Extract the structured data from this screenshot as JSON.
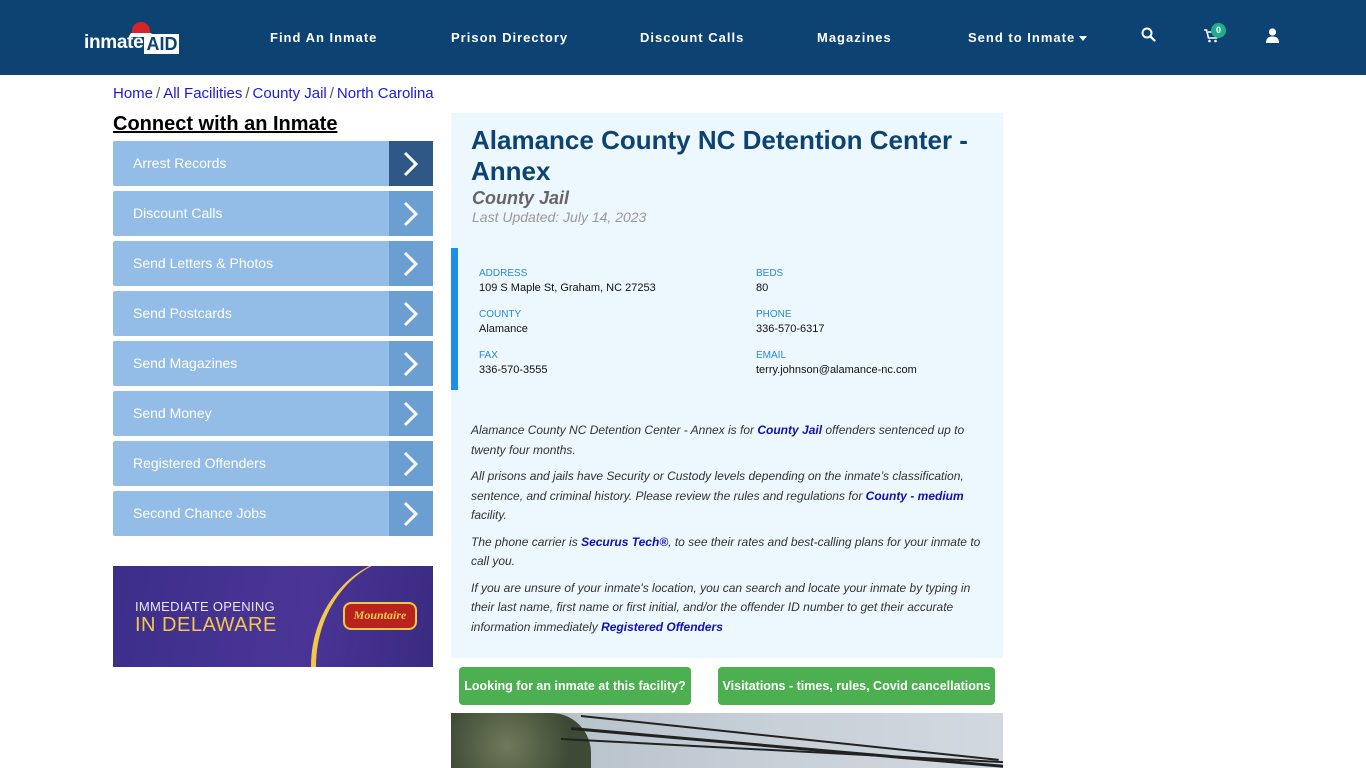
{
  "header": {
    "logo": {
      "text_main": "inmate",
      "text_accent": "AID"
    },
    "nav": [
      {
        "label": "Find An Inmate"
      },
      {
        "label": "Prison Directory"
      },
      {
        "label": "Discount Calls"
      },
      {
        "label": "Magazines"
      },
      {
        "label": "Send to Inmate",
        "has_dropdown": true
      }
    ],
    "icons": [
      "search-icon",
      "cart-icon",
      "user-icon"
    ],
    "cart_count": "0"
  },
  "breadcrumb": [
    {
      "label": "Home"
    },
    {
      "label": "All Facilities"
    },
    {
      "label": "County Jail"
    },
    {
      "label": "North Carolina"
    }
  ],
  "breadcrumb_sep": "/",
  "sidebar": {
    "title": "Connect with an Inmate",
    "items": [
      {
        "label": "Arrest Records"
      },
      {
        "label": "Discount Calls"
      },
      {
        "label": "Send Letters & Photos"
      },
      {
        "label": "Send Postcards"
      },
      {
        "label": "Send Magazines"
      },
      {
        "label": "Send Money"
      },
      {
        "label": "Registered Offenders"
      },
      {
        "label": "Second Chance Jobs"
      }
    ],
    "ad": {
      "line1": "IMMEDIATE OPENING",
      "line2": "IN DELAWARE",
      "brand": "Mountaire"
    }
  },
  "facility": {
    "title": "Alamance County NC Detention Center - Annex",
    "type": "County Jail",
    "last_updated": "Last Updated: July 14, 2023",
    "info": {
      "address_label": "ADDRESS",
      "address": "109 S Maple St, Graham, NC 27253",
      "beds_label": "BEDS",
      "beds": "80",
      "county_label": "COUNTY",
      "county": "Alamance",
      "phone_label": "PHONE",
      "phone": "336-570-6317",
      "fax_label": "FAX",
      "fax": "336-570-3555",
      "email_label": "EMAIL",
      "email": "terry.johnson@alamance-nc.com"
    },
    "description": {
      "p1_a": "Alamance County NC Detention Center - Annex is for ",
      "p1_link": "County Jail",
      "p1_b": " offenders sentenced up to twenty four months.",
      "p2_a": "All prisons and jails have Security or Custody levels depending on the inmate’s classification, sentence, and criminal history. Please review the rules and regulations for ",
      "p2_link": "County - medium",
      "p2_b": " facility.",
      "p3_a": "The phone carrier is ",
      "p3_link": "Securus Tech®",
      "p3_b": ", to see their rates and best-calling plans for your inmate to call you.",
      "p4_a": "If you are unsure of your inmate's location, you can search and locate your inmate by typing in their last name, first name or first initial, and/or the offender ID number to get their accurate information immediately ",
      "p4_link": "Registered Offenders"
    },
    "buttons": {
      "find_inmate": "Looking for an inmate at this facility?",
      "visitations": "Visitations - times, rules, Covid cancellations"
    }
  },
  "colors": {
    "navbar": "#0d4373",
    "accent_blue": "#1e8fe8",
    "sidebar_item": "#93bde6",
    "green_button": "#4caf50",
    "link": "#1010b8"
  }
}
